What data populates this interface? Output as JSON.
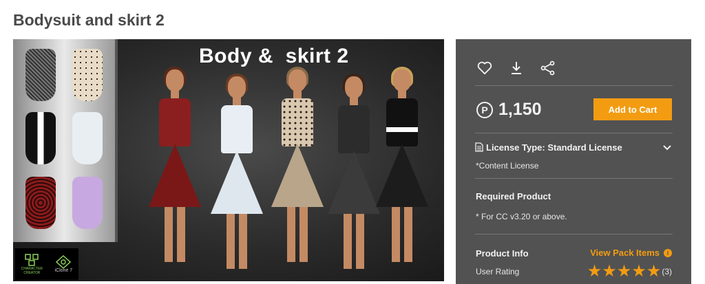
{
  "page": {
    "title": "Bodysuit and skirt 2"
  },
  "hero": {
    "caption": "Body &  skirt 2",
    "badges": {
      "cc_text": "CHARACTER\nCREATOR",
      "iclone_text": "iClone 7"
    }
  },
  "panel": {
    "price": "1,150",
    "currency_symbol": "P",
    "cart_label": "Add to Cart",
    "license_type": "License Type: Standard License",
    "content_license": "*Content License",
    "required_product_title": "Required Product",
    "required_product_note": "* For CC v3.20 or above.",
    "product_info_title": "Product Info",
    "view_pack_label": "View Pack Items",
    "user_rating_label": "User Rating",
    "rating_stars": 5,
    "rating_count": "(3)"
  },
  "colors": {
    "accent": "#f39c12",
    "panel_bg": "#525252"
  },
  "icons": [
    "heart-icon",
    "download-icon",
    "share-icon",
    "document-icon",
    "chevron-down-icon",
    "info-icon",
    "star-icon"
  ]
}
